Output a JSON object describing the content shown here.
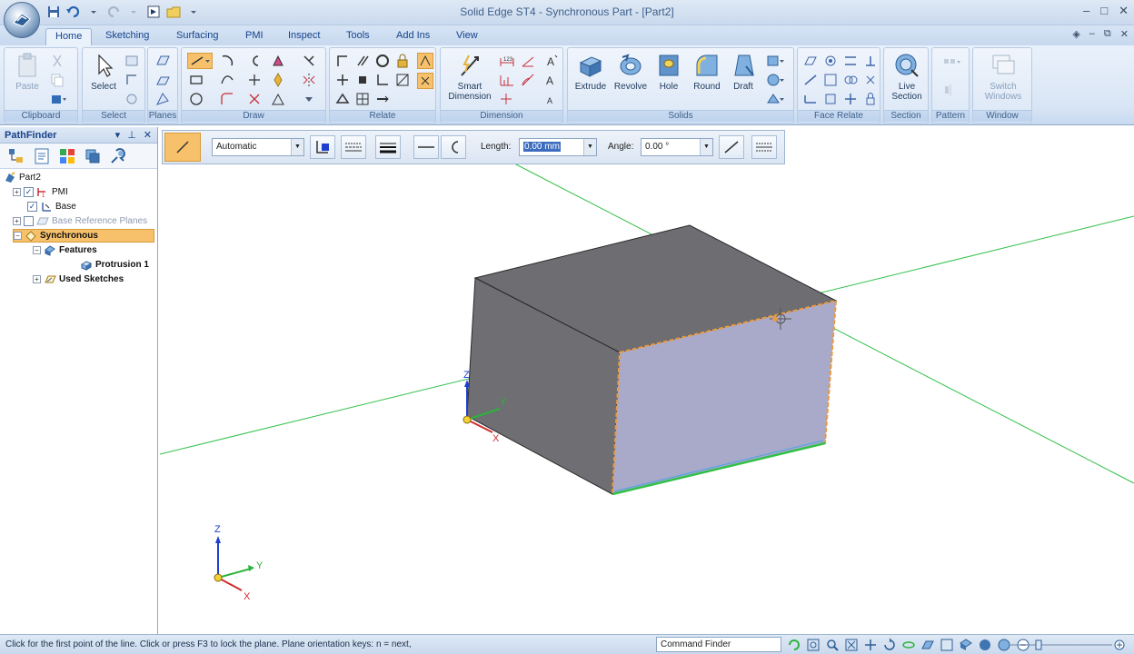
{
  "window": {
    "title": "Solid Edge ST4 - Synchronous Part - [Part2]",
    "controls": [
      "–",
      "□",
      "✕"
    ]
  },
  "ribbon_tabs": [
    "Home",
    "Sketching",
    "Surfacing",
    "PMI",
    "Inspect",
    "Tools",
    "Add Ins",
    "View"
  ],
  "ribbon": {
    "clipboard": {
      "label": "Clipboard",
      "paste": "Paste"
    },
    "select": {
      "label": "Select",
      "select_btn": "Select"
    },
    "planes": {
      "label": "Planes"
    },
    "draw": {
      "label": "Draw"
    },
    "relate": {
      "label": "Relate"
    },
    "dimension": {
      "label": "Dimension",
      "smart_dim": "Smart Dimension"
    },
    "solids": {
      "label": "Solids",
      "extrude": "Extrude",
      "revolve": "Revolve",
      "hole": "Hole",
      "round": "Round",
      "draft": "Draft"
    },
    "face_relate": {
      "label": "Face Relate"
    },
    "section": {
      "label": "Section",
      "live_section": "Live Section"
    },
    "pattern": {
      "label": "Pattern"
    },
    "window": {
      "label": "Window",
      "switch_windows": "Switch Windows"
    }
  },
  "command_bar": {
    "mode_value": "Automatic",
    "length_label": "Length:",
    "length_value": "0.00 mm",
    "angle_label": "Angle:",
    "angle_value": "0.00 °"
  },
  "pathfinder": {
    "title": "PathFinder",
    "nodes": {
      "part": "Part2",
      "pmi": "PMI",
      "base": "Base",
      "base_ref": "Base Reference Planes",
      "synchronous": "Synchronous",
      "features": "Features",
      "protrusion": "Protrusion 1",
      "used_sketches": "Used Sketches"
    }
  },
  "viewport": {
    "axis_labels": {
      "x": "X",
      "y": "Y",
      "z": "Z"
    }
  },
  "status": {
    "message": "Click for the first point of the line.  Click or press F3 to lock the plane.  Plane orientation keys: n = next,",
    "command_finder": "Command Finder"
  },
  "colors": {
    "accent_orange": "#f7c16b",
    "ribbon_blue": "#dae6f5",
    "axis_green": "#33c04a",
    "face_highlight": "#a9a9c9"
  }
}
